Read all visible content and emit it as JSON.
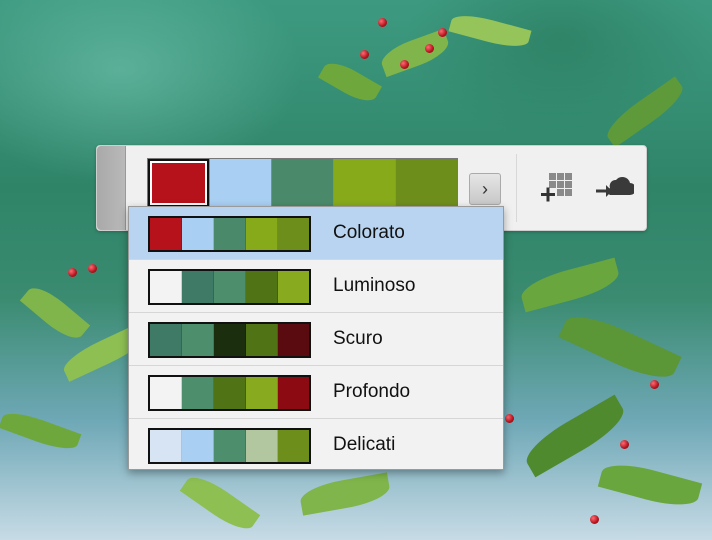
{
  "toolbar": {
    "main_swatches": [
      "#b5121b",
      "#a9cff2",
      "#4a8a6a",
      "#87aa1b",
      "#6e8e1c"
    ],
    "next_label": "›",
    "grid_icon": "add-grid-icon",
    "cloud_icon": "upload-cloud-icon"
  },
  "menu": {
    "items": [
      {
        "label": "Colorato",
        "colors": [
          "#b5121b",
          "#a9cff2",
          "#4a8a6a",
          "#87aa1b",
          "#6e8e1c"
        ],
        "active": true
      },
      {
        "label": "Luminoso",
        "colors": [
          "#f3f3f3",
          "#3f7a66",
          "#4d8f6d",
          "#4f7315",
          "#88aa1e"
        ],
        "active": false
      },
      {
        "label": "Scuro",
        "colors": [
          "#3f7a66",
          "#4d8f6d",
          "#1b2e0d",
          "#4f7315",
          "#5a0b0f"
        ],
        "active": false
      },
      {
        "label": "Profondo",
        "colors": [
          "#f3f3f3",
          "#4d8f6d",
          "#4f7315",
          "#88aa1e",
          "#8c0b12"
        ],
        "active": false
      },
      {
        "label": "Delicati",
        "colors": [
          "#d6e4f4",
          "#a9cff2",
          "#4d8f6d",
          "#b2c7a0",
          "#6e8e1c"
        ],
        "active": false
      }
    ]
  }
}
